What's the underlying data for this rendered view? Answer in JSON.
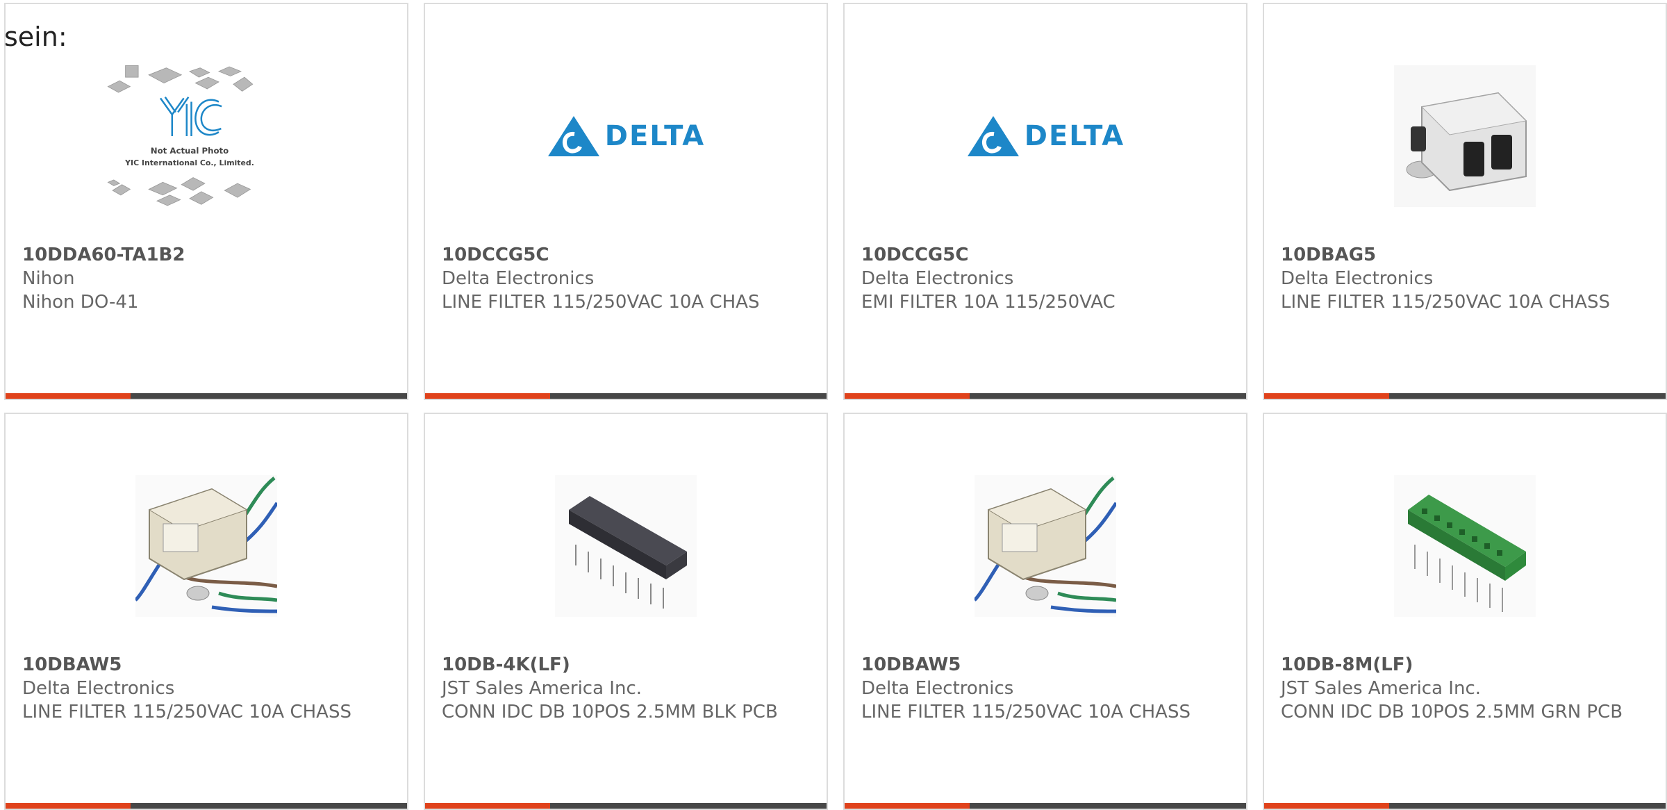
{
  "intro_text": "sein:",
  "colors": {
    "accent": "#e0421b",
    "bar": "#474747",
    "card_border": "#dcdcdc",
    "delta_blue": "#1d87c8"
  },
  "placeholder": {
    "line1": "Not Actual Photo",
    "line2": "YIC International Co., Limited."
  },
  "logo": {
    "delta": "DELTA"
  },
  "products": [
    {
      "part_number": "10DDA60-TA1B2",
      "manufacturer": "Nihon",
      "description": "Nihon DO-41",
      "image": "yic-placeholder"
    },
    {
      "part_number": "10DCCG5C",
      "manufacturer": "Delta Electronics",
      "description": "LINE FILTER 115/250VAC 10A CHAS",
      "image": "delta-logo"
    },
    {
      "part_number": "10DCCG5C",
      "manufacturer": "Delta Electronics",
      "description": "EMI FILTER 10A 115/250VAC",
      "image": "delta-logo"
    },
    {
      "part_number": "10DBAG5",
      "manufacturer": "Delta Electronics",
      "description": "LINE FILTER 115/250VAC 10A CHASS",
      "image": "metal-filter"
    },
    {
      "part_number": "10DBAW5",
      "manufacturer": "Delta Electronics",
      "description": "LINE FILTER 115/250VAC 10A CHASS",
      "image": "wired-filter"
    },
    {
      "part_number": "10DB-4K(LF)",
      "manufacturer": "JST Sales America Inc.",
      "description": "CONN IDC DB 10POS 2.5MM BLK PCB",
      "image": "black-connector"
    },
    {
      "part_number": "10DBAW5",
      "manufacturer": "Delta Electronics",
      "description": "LINE FILTER 115/250VAC 10A CHASS",
      "image": "wired-filter"
    },
    {
      "part_number": "10DB-8M(LF)",
      "manufacturer": "JST Sales America Inc.",
      "description": "CONN IDC DB 10POS 2.5MM GRN PCB",
      "image": "green-connector"
    }
  ]
}
